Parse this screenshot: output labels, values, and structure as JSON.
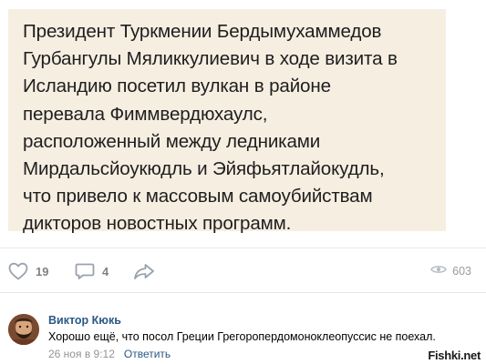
{
  "post": {
    "text_lines": [
      "Президент Туркмении Бердымухаммедов",
      "Гурбангулы Мяликкулиевич в ходе визита в",
      "Исландию посетил вулкан в районе",
      "перевала Фиммвердюхаулс,",
      "расположенный между ледниками",
      "Мирдальсйоукюдль и Эйяфьятлайокудль,",
      "что привело к массовым самоубийствам",
      "дикторов новостных программ."
    ],
    "image_background": "#f7eee2"
  },
  "actions": {
    "likes": "19",
    "comments": "4",
    "views": "603",
    "icons": [
      "heart-icon",
      "comment-icon",
      "share-icon",
      "eye-icon"
    ]
  },
  "comment": {
    "author": "Виктор Кюкь",
    "text": "Хорошо ещё, что посол Греции Грегоропердомоноклеопуссис не поехал.",
    "date": "26 ноя в 9:12",
    "reply_label": "Ответить"
  },
  "watermark": "Fishki.net",
  "colors": {
    "link": "#2a5885",
    "muted": "#939393",
    "icon": "#99a2ad"
  }
}
